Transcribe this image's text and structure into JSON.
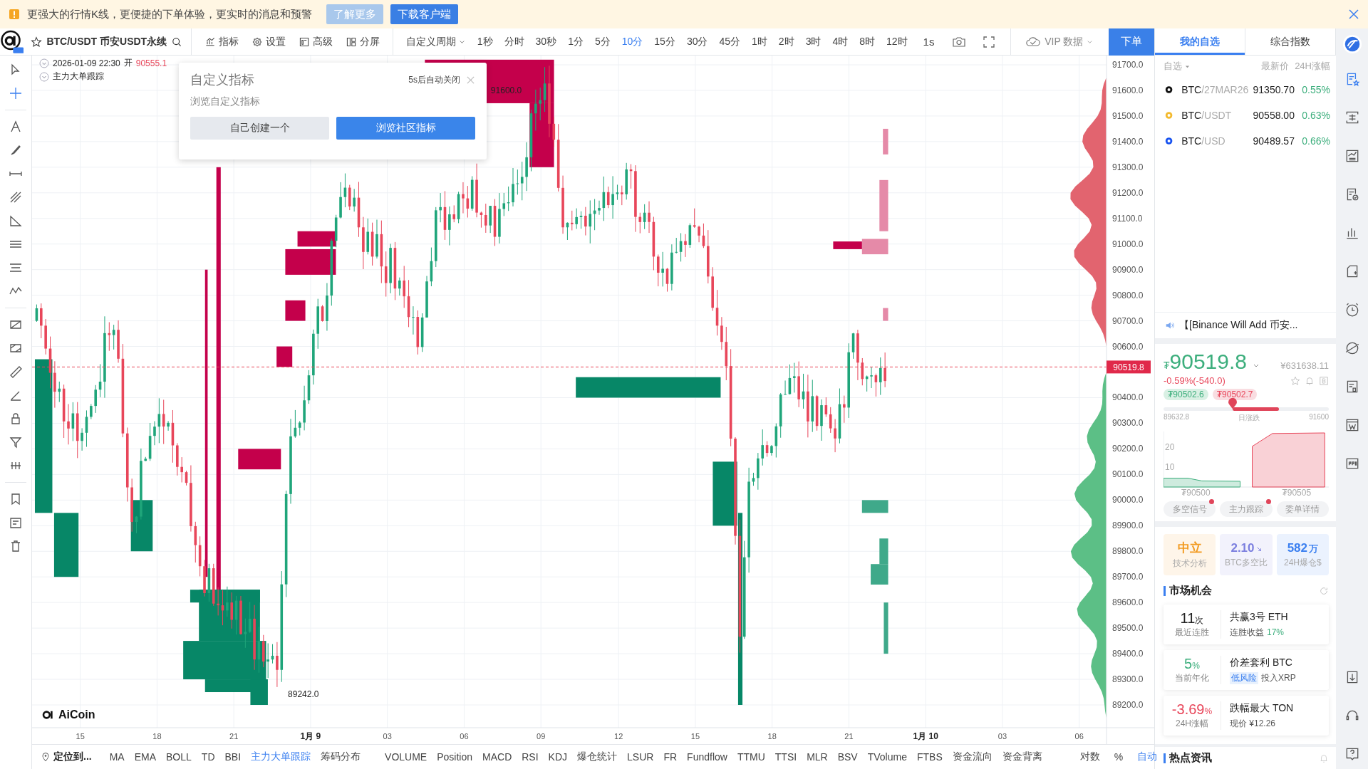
{
  "banner": {
    "message": "更强大的行情K线，更便捷的下单体验，更实时的消息和预警",
    "buttons": [
      {
        "label": "了解更多",
        "kind": "light"
      },
      {
        "label": "下载客户端",
        "kind": "primary"
      }
    ]
  },
  "toolbar": {
    "symbol": "BTC/USDT 币安USDT永续",
    "menus": [
      {
        "label": "指标",
        "kind": "indicator"
      },
      {
        "label": "设置",
        "kind": "settings"
      },
      {
        "label": "高级",
        "kind": "advanced"
      },
      {
        "label": "分屏",
        "kind": "split"
      }
    ],
    "period_menu": "自定义周期",
    "periods": [
      {
        "label": "1秒",
        "selected": false
      },
      {
        "label": "分时",
        "selected": false
      },
      {
        "label": "30秒",
        "selected": false
      },
      {
        "label": "1分",
        "selected": false
      },
      {
        "label": "5分",
        "selected": false
      },
      {
        "label": "10分",
        "selected": true
      },
      {
        "label": "15分",
        "selected": false
      },
      {
        "label": "30分",
        "selected": false
      },
      {
        "label": "45分",
        "selected": false
      },
      {
        "label": "1时",
        "selected": false
      },
      {
        "label": "2时",
        "selected": false
      },
      {
        "label": "3时",
        "selected": false
      },
      {
        "label": "4时",
        "selected": false
      },
      {
        "label": "8时",
        "selected": false
      },
      {
        "label": "12时",
        "selected": false
      }
    ],
    "interval": "1s",
    "vip": "VIP 数据",
    "order_button": "下单"
  },
  "chart": {
    "info": {
      "time": "2026-01-09 22:30",
      "open_label": "开",
      "open": "90555.1"
    },
    "indicator_label": "主力大单跟踪",
    "price_ticks": [
      "91700.0",
      "91600.0",
      "91500.0",
      "91400.0",
      "91300.0",
      "91200.0",
      "91100.0",
      "91000.0",
      "90900.0",
      "90800.0",
      "90700.0",
      "90600.0",
      "90400.0",
      "90300.0",
      "90200.0",
      "90100.0",
      "90000.0",
      "89900.0",
      "89800.0",
      "89700.0",
      "89600.0",
      "89500.0",
      "89400.0",
      "89300.0",
      "89200.0"
    ],
    "current_price": "90519.8",
    "time_ticks": [
      {
        "label": "15",
        "kind": "hour"
      },
      {
        "label": "18",
        "kind": "hour"
      },
      {
        "label": "21",
        "kind": "hour"
      },
      {
        "label": "1月 9",
        "kind": "date"
      },
      {
        "label": "03",
        "kind": "hour"
      },
      {
        "label": "06",
        "kind": "hour"
      },
      {
        "label": "09",
        "kind": "hour"
      },
      {
        "label": "12",
        "kind": "hour"
      },
      {
        "label": "15",
        "kind": "hour"
      },
      {
        "label": "18",
        "kind": "hour"
      },
      {
        "label": "21",
        "kind": "hour"
      },
      {
        "label": "1月 10",
        "kind": "date"
      },
      {
        "label": "03",
        "kind": "hour"
      },
      {
        "label": "06",
        "kind": "hour"
      }
    ],
    "annotations": [
      "91600.0",
      "89242.0"
    ],
    "brand": "AiCoin"
  },
  "popup": {
    "title": "自定义指标",
    "auto_close": "5s后自动关闭",
    "subtitle": "浏览自定义指标",
    "buttons": [
      {
        "label": "自己创建一个",
        "kind": "secondary"
      },
      {
        "label": "浏览社区指标",
        "kind": "primary"
      }
    ]
  },
  "bottom_bar": {
    "locate": "定位到...",
    "main_indicators": [
      {
        "label": "MA",
        "selected": false
      },
      {
        "label": "EMA",
        "selected": false
      },
      {
        "label": "BOLL",
        "selected": false
      },
      {
        "label": "TD",
        "selected": false
      },
      {
        "label": "BBI",
        "selected": false
      },
      {
        "label": "主力大单跟踪",
        "selected": true
      },
      {
        "label": "筹码分布",
        "selected": false
      }
    ],
    "sub_indicators": [
      {
        "label": "VOLUME",
        "selected": false
      },
      {
        "label": "Position",
        "selected": false
      },
      {
        "label": "MACD",
        "selected": false
      },
      {
        "label": "RSI",
        "selected": false
      },
      {
        "label": "KDJ",
        "selected": false
      },
      {
        "label": "爆仓统计",
        "selected": false
      },
      {
        "label": "LSUR",
        "selected": false
      },
      {
        "label": "FR",
        "selected": false
      },
      {
        "label": "Fundflow",
        "selected": false
      },
      {
        "label": "TTMU",
        "selected": false
      },
      {
        "label": "TTSI",
        "selected": false
      },
      {
        "label": "MLR",
        "selected": false
      },
      {
        "label": "BSV",
        "selected": false
      },
      {
        "label": "TVolume",
        "selected": false
      },
      {
        "label": "FTBS",
        "selected": false
      },
      {
        "label": "资金流向",
        "selected": false
      },
      {
        "label": "资金背离",
        "selected": false
      }
    ],
    "options": [
      {
        "label": "对数",
        "selected": false
      },
      {
        "label": "%",
        "selected": false
      },
      {
        "label": "自动",
        "selected": true
      }
    ]
  },
  "right_panel": {
    "tabs": [
      {
        "label": "我的自选",
        "selected": true
      },
      {
        "label": "综合指数",
        "selected": false
      }
    ],
    "list_header": {
      "filter": "自选",
      "price": "最新价",
      "change": "24H涨幅"
    },
    "watchlist": [
      {
        "base": "BTC",
        "quote": "/27MAR26",
        "price": "91350.70",
        "change": "0.55%",
        "color": "#111111"
      },
      {
        "base": "BTC",
        "quote": "/USDT",
        "price": "90558.00",
        "change": "0.63%",
        "color": "#f3ba2f"
      },
      {
        "base": "BTC",
        "quote": "/USD",
        "price": "90489.57",
        "change": "0.66%",
        "color": "#1652f0"
      }
    ],
    "news": "【[Binance Will Add 币安...",
    "quote": {
      "currency": "₮",
      "price": "90519.8",
      "cny": "¥631638.11",
      "change": "-0.59%(-540.0)",
      "bid": "₮90502.6",
      "ask": "₮90502.7"
    },
    "range": {
      "low": "89632.8",
      "label": "日涨跌",
      "high": "91600"
    },
    "depth": {
      "chart_data": {
        "type": "area",
        "x": [
          90498.4,
          90499.6,
          90500.3,
          90502.2,
          90502.8,
          90503.8,
          90506.4
        ],
        "xlim": [
          90498.4,
          90506.6
        ],
        "ylim": [
          0,
          28
        ],
        "yticks": [
          10,
          20
        ],
        "xticks": [
          {
            "value": 90500,
            "label": "₮90500"
          },
          {
            "value": 90505,
            "label": "₮90505"
          }
        ],
        "series": [
          {
            "color": "#3cae7c",
            "values": [
              4.5,
              4.5,
              3.1,
              2.9,
              null,
              null,
              null
            ]
          },
          {
            "color": "#e8465a",
            "values": [
              null,
              null,
              null,
              null,
              20.5,
              27,
              27.3
            ]
          }
        ]
      }
    },
    "signals": [
      {
        "label": "多空信号",
        "dot": true
      },
      {
        "label": "主力跟踪",
        "dot": true
      },
      {
        "label": "委单详情",
        "dot": false
      }
    ],
    "stats": [
      {
        "value": "中立",
        "label": "技术分析",
        "color": "#f29a1f"
      },
      {
        "value": "2.10",
        "label": "BTC多空比",
        "color": "#7b7fdf",
        "falling": true
      },
      {
        "value": "582",
        "unit": "万",
        "label": "24H爆仓$",
        "color": "#3a7ff0"
      }
    ],
    "opportunities_title": "市场机会",
    "opportunities": [
      {
        "value": "11",
        "unit": "次",
        "color": "#222222",
        "label": "最近连胜",
        "title": "共赢3号 ETH",
        "sub": "连胜收益",
        "highlight": "17%"
      },
      {
        "value": "5",
        "unit": "%",
        "color": "#3cae7c",
        "label": "当前年化",
        "title": "价差套利 BTC",
        "tag": "低风险",
        "sub": "投入XRP"
      },
      {
        "value": "-3.69",
        "unit": "%",
        "color": "#e8465a",
        "label": "24H涨幅",
        "title": "跌幅最大 TON",
        "sub": "现价 ¥12.26"
      }
    ],
    "news_title": "热点资讯"
  }
}
